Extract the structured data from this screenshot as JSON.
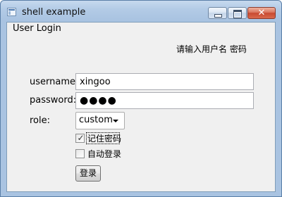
{
  "window": {
    "title": "shell example",
    "close_glyph": "✕"
  },
  "group": {
    "title": "User Login"
  },
  "form": {
    "prompt": "请输入用户名 密码",
    "username_label": "username:",
    "username_value": "xingoo",
    "password_label": "password:",
    "password_value": "●●●●",
    "role_label": "role:",
    "role_value": "custom",
    "remember_label": "记住密码",
    "remember_checked": true,
    "checkmark": "✓",
    "auto_login_label": "自动登录",
    "auto_login_checked": false,
    "login_button": "登录"
  },
  "icons": {
    "app": "window-app-icon",
    "minimize": "minimize-icon",
    "maximize": "maximize-icon",
    "close": "close-icon",
    "dropdown": "chevron-down-icon"
  },
  "colors": {
    "titlebar": "#b3cbe6",
    "close_button": "#c84a30",
    "client_background": "#f0f0f0"
  }
}
